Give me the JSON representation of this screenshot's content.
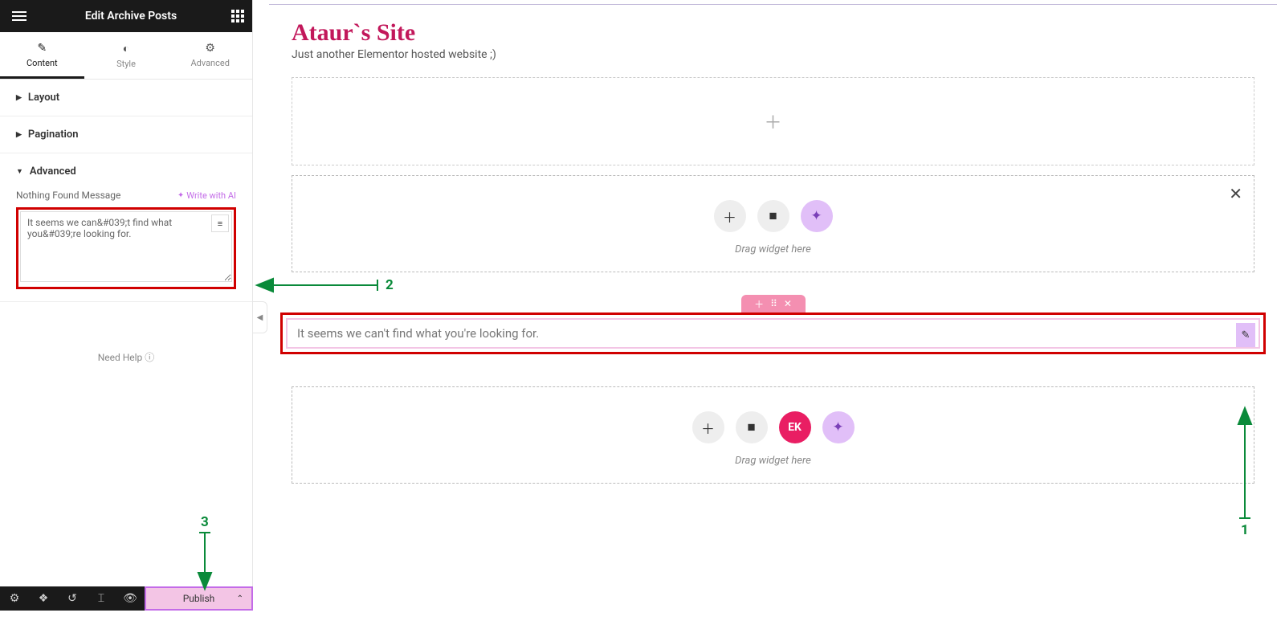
{
  "panel": {
    "title": "Edit Archive Posts",
    "tabs": {
      "content": "Content",
      "style": "Style",
      "advanced": "Advanced"
    },
    "sections": {
      "layout": "Layout",
      "pagination": "Pagination",
      "advanced": "Advanced"
    },
    "advanced_section": {
      "field_label": "Nothing Found Message",
      "ai_link": "Write with AI",
      "textarea_value": "It seems we can&#039;t find what you&#039;re looking for."
    },
    "need_help": "Need Help"
  },
  "bottombar": {
    "publish": "Publish"
  },
  "canvas": {
    "site_title": "Ataur`s Site",
    "site_tag": "Just another Elementor hosted website ;)",
    "drag_text": "Drag widget here",
    "widget_text": "It seems we can't find what you're looking for.",
    "ek_label": "EK"
  },
  "annotations": {
    "n1": "1",
    "n2": "2",
    "n3": "3"
  }
}
